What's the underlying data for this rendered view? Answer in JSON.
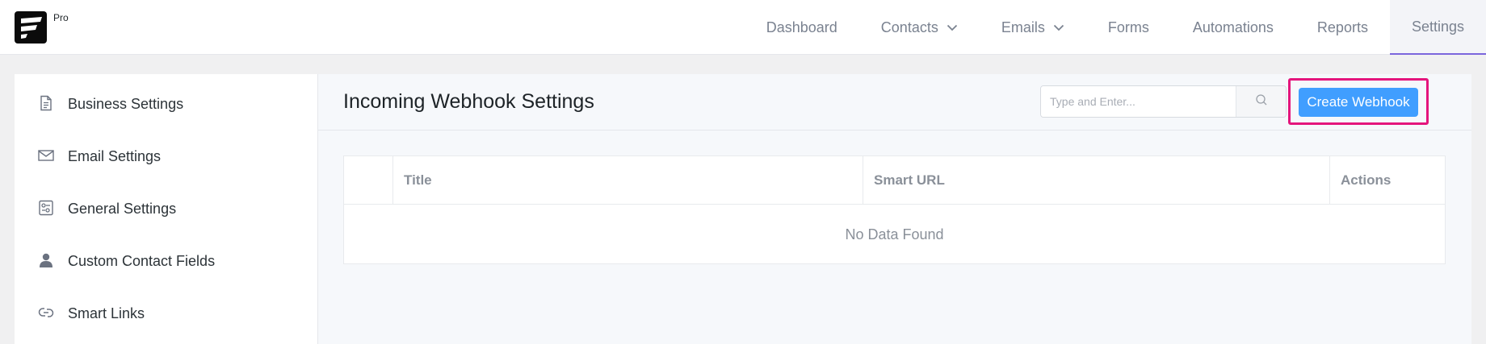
{
  "app": {
    "badge": "Pro"
  },
  "nav": {
    "items": [
      {
        "label": "Dashboard",
        "dropdown": false,
        "active": false
      },
      {
        "label": "Contacts",
        "dropdown": true,
        "active": false
      },
      {
        "label": "Emails",
        "dropdown": true,
        "active": false
      },
      {
        "label": "Forms",
        "dropdown": false,
        "active": false
      },
      {
        "label": "Automations",
        "dropdown": false,
        "active": false
      },
      {
        "label": "Reports",
        "dropdown": false,
        "active": false
      },
      {
        "label": "Settings",
        "dropdown": false,
        "active": true
      }
    ]
  },
  "sidebar": {
    "items": [
      {
        "label": "Business Settings",
        "icon": "document-icon"
      },
      {
        "label": "Email Settings",
        "icon": "envelope-icon"
      },
      {
        "label": "General Settings",
        "icon": "sliders-icon"
      },
      {
        "label": "Custom Contact Fields",
        "icon": "person-icon"
      },
      {
        "label": "Smart Links",
        "icon": "link-icon"
      }
    ]
  },
  "main": {
    "title": "Incoming Webhook Settings",
    "search": {
      "placeholder": "Type and Enter...",
      "value": ""
    },
    "create_button": "Create Webhook",
    "table": {
      "columns": [
        "",
        "Title",
        "Smart URL",
        "Actions"
      ],
      "rows": [],
      "empty_text": "No Data Found"
    }
  },
  "colors": {
    "accent": "#409eff",
    "highlight": "#e4157c",
    "active_underline": "#7b66dc"
  }
}
